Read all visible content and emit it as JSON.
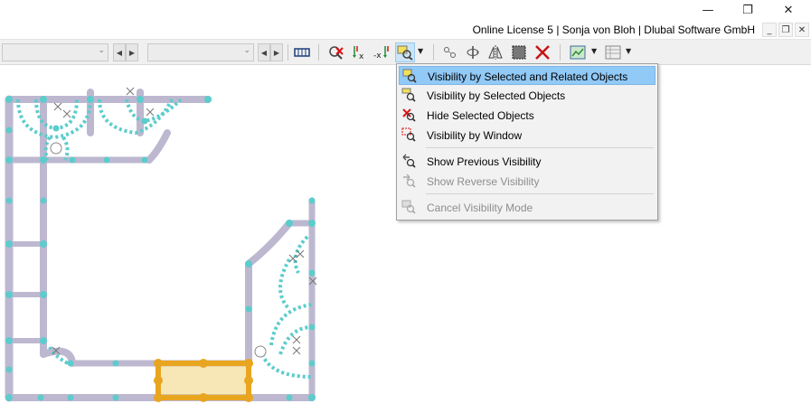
{
  "window": {
    "minimize_glyph": "—",
    "restore_glyph": "❐",
    "close_glyph": "✕"
  },
  "license": {
    "text": "Online License 5 | Sonja von Bloh | Dlubal Software GmbH",
    "mdi_minimize": "_",
    "mdi_restore": "❐",
    "mdi_close": "✕"
  },
  "toolbar": {
    "combo1_value": "",
    "combo2_value": "",
    "spin_left": "◀",
    "spin_right": "▶",
    "dropdown_arrow": "▼",
    "icons": [
      "mesh-icon",
      "visibility-off-icon",
      "move-x-icon",
      "move-negx-icon",
      "visibility-mode-icon",
      "node-icon",
      "rotate-icon",
      "mirror-icon",
      "select-window-icon",
      "delete-cross-icon",
      "view-icon",
      "table-icon"
    ]
  },
  "menu": {
    "items": [
      {
        "label": "Visibility by Selected and Related Objects",
        "icon": "visibility-selected-related-icon",
        "enabled": true,
        "highlighted": true
      },
      {
        "label": "Visibility by Selected Objects",
        "icon": "visibility-selected-icon",
        "enabled": true
      },
      {
        "label": "Hide Selected Objects",
        "icon": "hide-selected-icon",
        "enabled": true
      },
      {
        "label": "Visibility by Window",
        "icon": "visibility-window-icon",
        "enabled": true
      },
      {
        "label": "Show Previous Visibility",
        "icon": "show-previous-icon",
        "enabled": true
      },
      {
        "label": "Show Reverse Visibility",
        "icon": "show-reverse-icon",
        "enabled": false
      },
      {
        "label": "Cancel Visibility Mode",
        "icon": "cancel-visibility-icon",
        "enabled": false
      }
    ]
  },
  "colors": {
    "member": "#bdb8d0",
    "node": "#5ccccc",
    "selected": "#e8a520",
    "highlight": "#91c9f7"
  }
}
